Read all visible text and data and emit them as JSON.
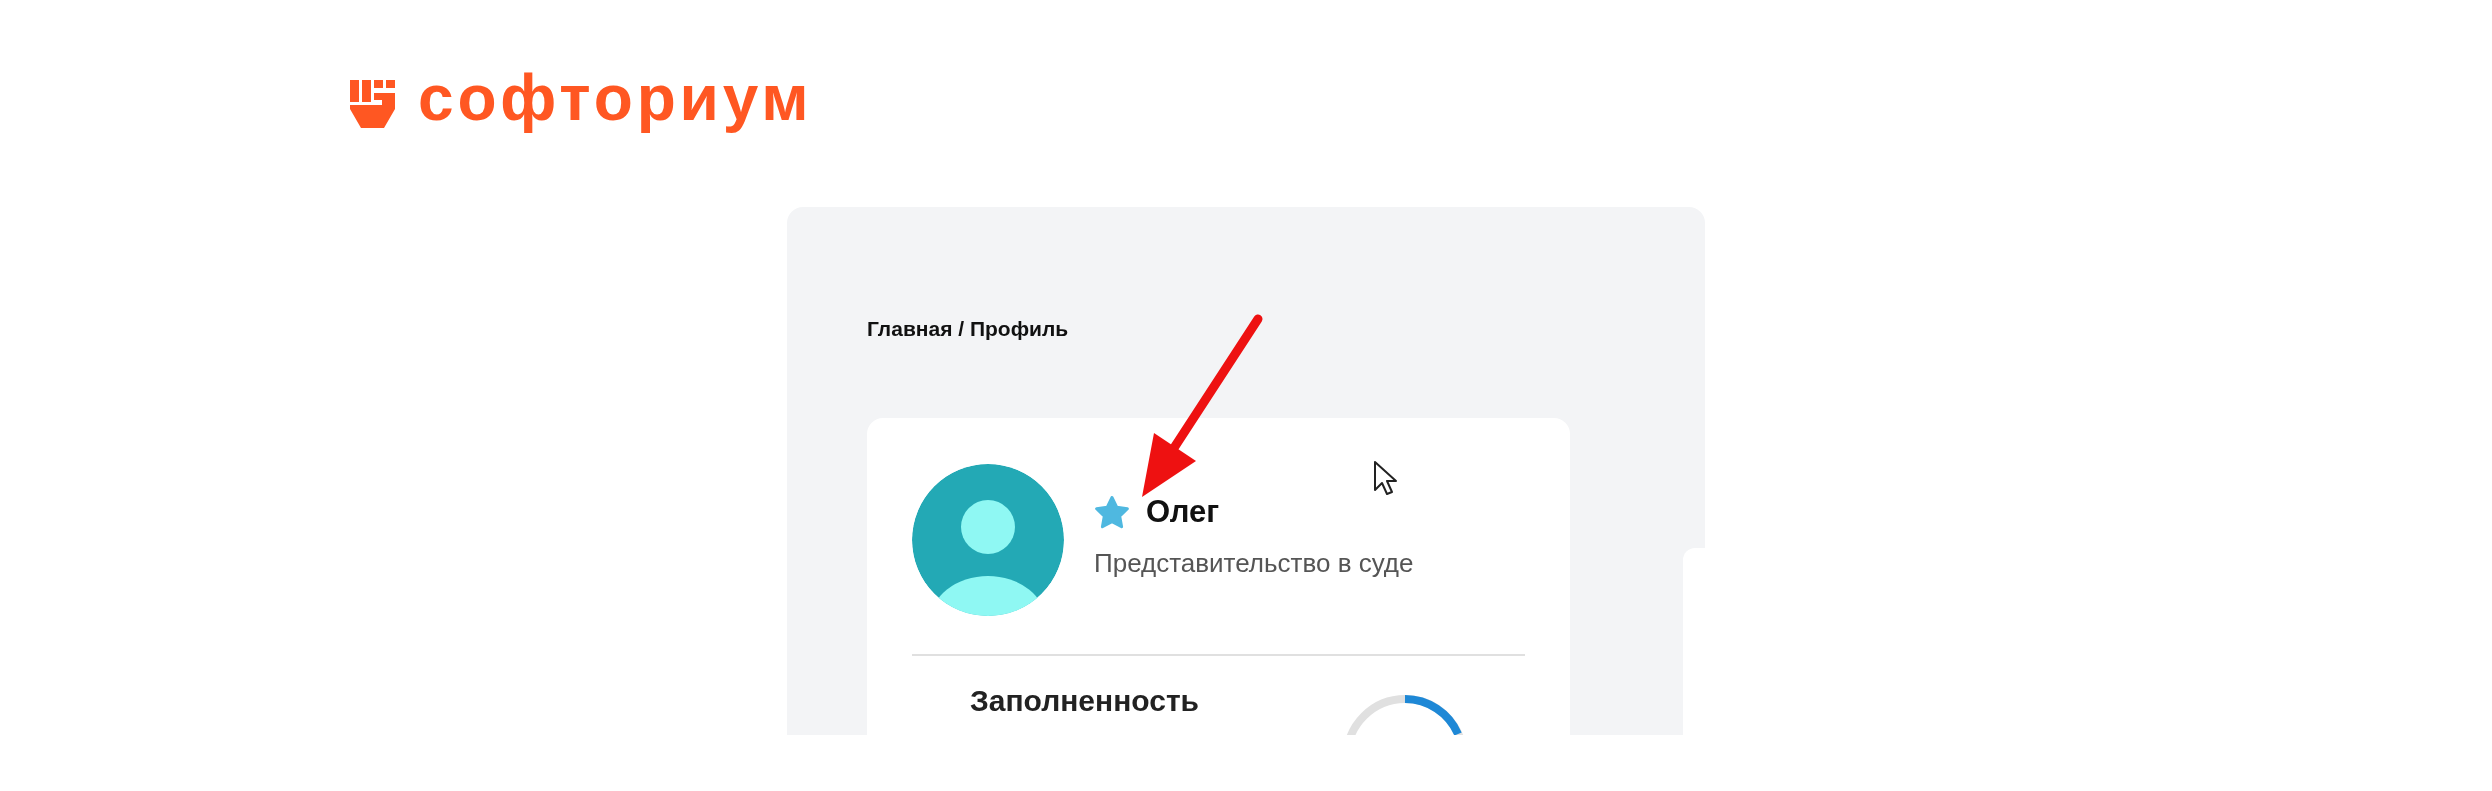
{
  "logo": {
    "text": "софториум"
  },
  "breadcrumb": "Главная / Профиль",
  "profile": {
    "name": "Олег",
    "subtitle": "Представительство в суде"
  },
  "completeness": {
    "label": "Заполненность"
  }
}
